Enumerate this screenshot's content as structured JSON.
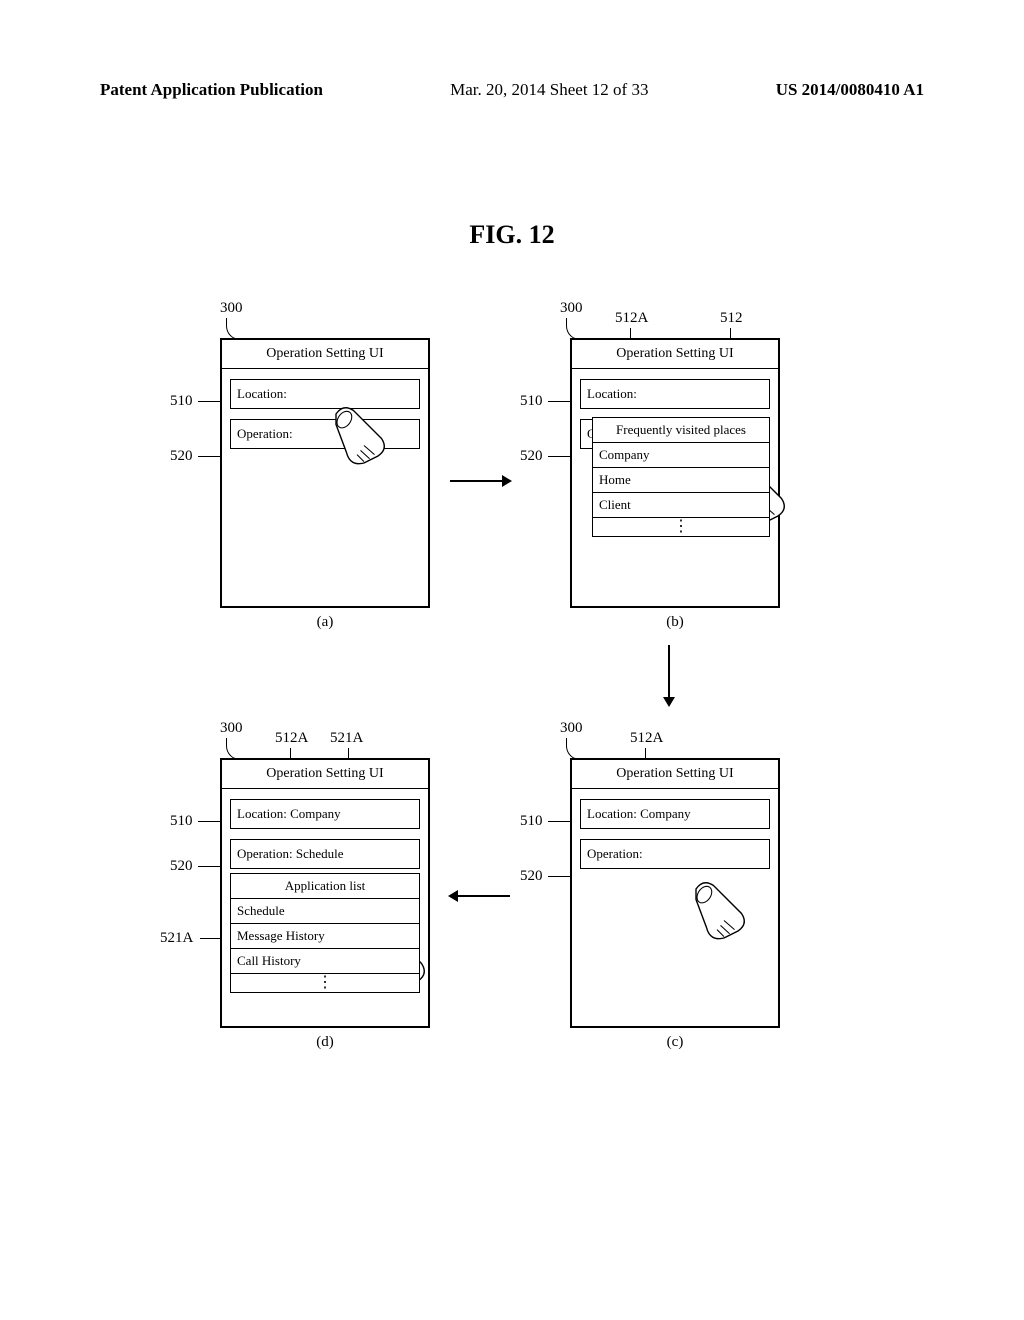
{
  "header": {
    "left": "Patent Application Publication",
    "center": "Mar. 20, 2014  Sheet 12 of 33",
    "right": "US 2014/0080410 A1"
  },
  "figure_title": "FIG. 12",
  "refs": {
    "r300": "300",
    "r510": "510",
    "r520": "520",
    "r512": "512",
    "r512A": "512A",
    "r521A": "521A"
  },
  "captions": {
    "a": "(a)",
    "b": "(b)",
    "c": "(c)",
    "d": "(d)"
  },
  "ui": {
    "title": "Operation Setting UI",
    "location_label": "Location:",
    "operation_label": "Operation:",
    "location_selected": "Location: Company",
    "operation_selected": "Operation: Schedule"
  },
  "dropdown_places": {
    "header": "Frequently visited places",
    "items": [
      "Company",
      "Home",
      "Client"
    ]
  },
  "dropdown_apps": {
    "header": "Application list",
    "items": [
      "Schedule",
      "Message History",
      "Call History"
    ]
  }
}
